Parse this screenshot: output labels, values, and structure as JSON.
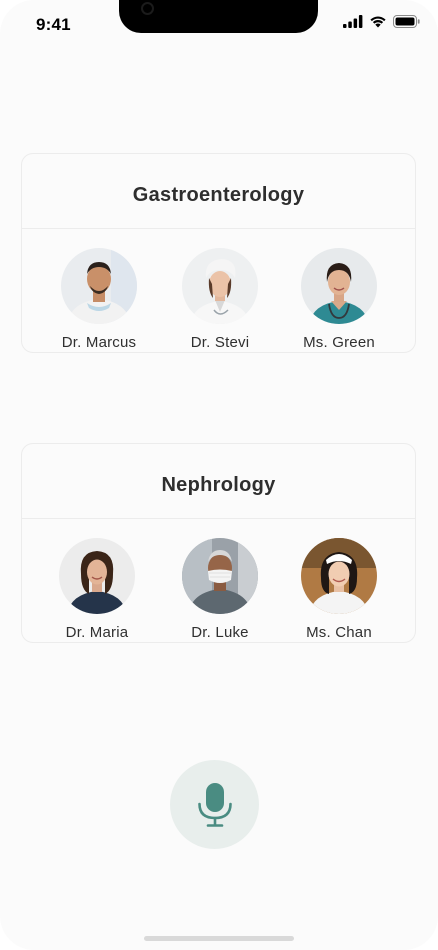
{
  "status_bar": {
    "time": "9:41"
  },
  "departments": [
    {
      "title": "Gastroenterology",
      "doctors": [
        {
          "name": "Dr. Marcus"
        },
        {
          "name": "Dr. Stevi"
        },
        {
          "name": "Ms. Green"
        }
      ]
    },
    {
      "title": "Nephrology",
      "doctors": [
        {
          "name": "Dr. Maria"
        },
        {
          "name": "Dr. Luke"
        },
        {
          "name": "Ms. Chan"
        }
      ]
    }
  ],
  "colors": {
    "accent": "#4a8c82",
    "mic_background": "#e8eeec",
    "title_text": "#2e2e2e"
  },
  "icons": {
    "microphone": "microphone-icon",
    "signal": "cellular-signal-icon",
    "wifi": "wifi-icon",
    "battery": "battery-icon"
  }
}
